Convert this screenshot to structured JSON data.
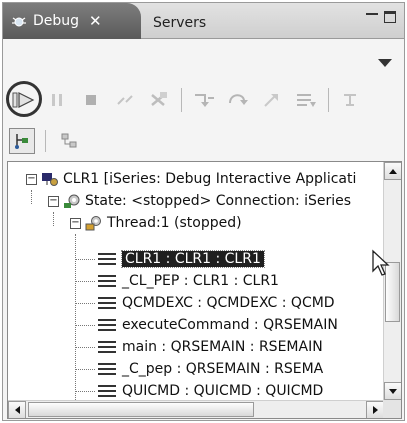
{
  "tabs": {
    "debug_label": "Debug",
    "close_glyph": "✕",
    "servers_label": "Servers"
  },
  "colors": {
    "active_tab": "#6a6a6a",
    "selection_bg": "#1f1f1f",
    "resume_icon": "#2e7d2e"
  },
  "toolbar": {
    "icons": [
      "resume-icon",
      "suspend-icon",
      "terminate-icon",
      "disconnect-icon",
      "remove-terminated-icon",
      "step-into-icon",
      "step-over-icon",
      "step-return-icon",
      "drop-to-frame-icon",
      "use-step-filters-icon"
    ]
  },
  "tree": {
    "root_label": "CLR1 [iSeries: Debug Interactive Applicati",
    "state_label": "State: <stopped> Connection: iSeries",
    "thread_label": "Thread:1 (stopped)",
    "frames": [
      "CLR1 : CLR1 : CLR1",
      "_CL_PEP : CLR1 : CLR1",
      "QCMDEXC : QCMDEXC : QCMD",
      "executeCommand : QRSEMAIN",
      "main : QRSEMAIN : RSEMAIN",
      "_C_pep : QRSEMAIN : RSEMA",
      "QUICMD : QUICMD : QUICMD"
    ],
    "selected_index": 0
  }
}
